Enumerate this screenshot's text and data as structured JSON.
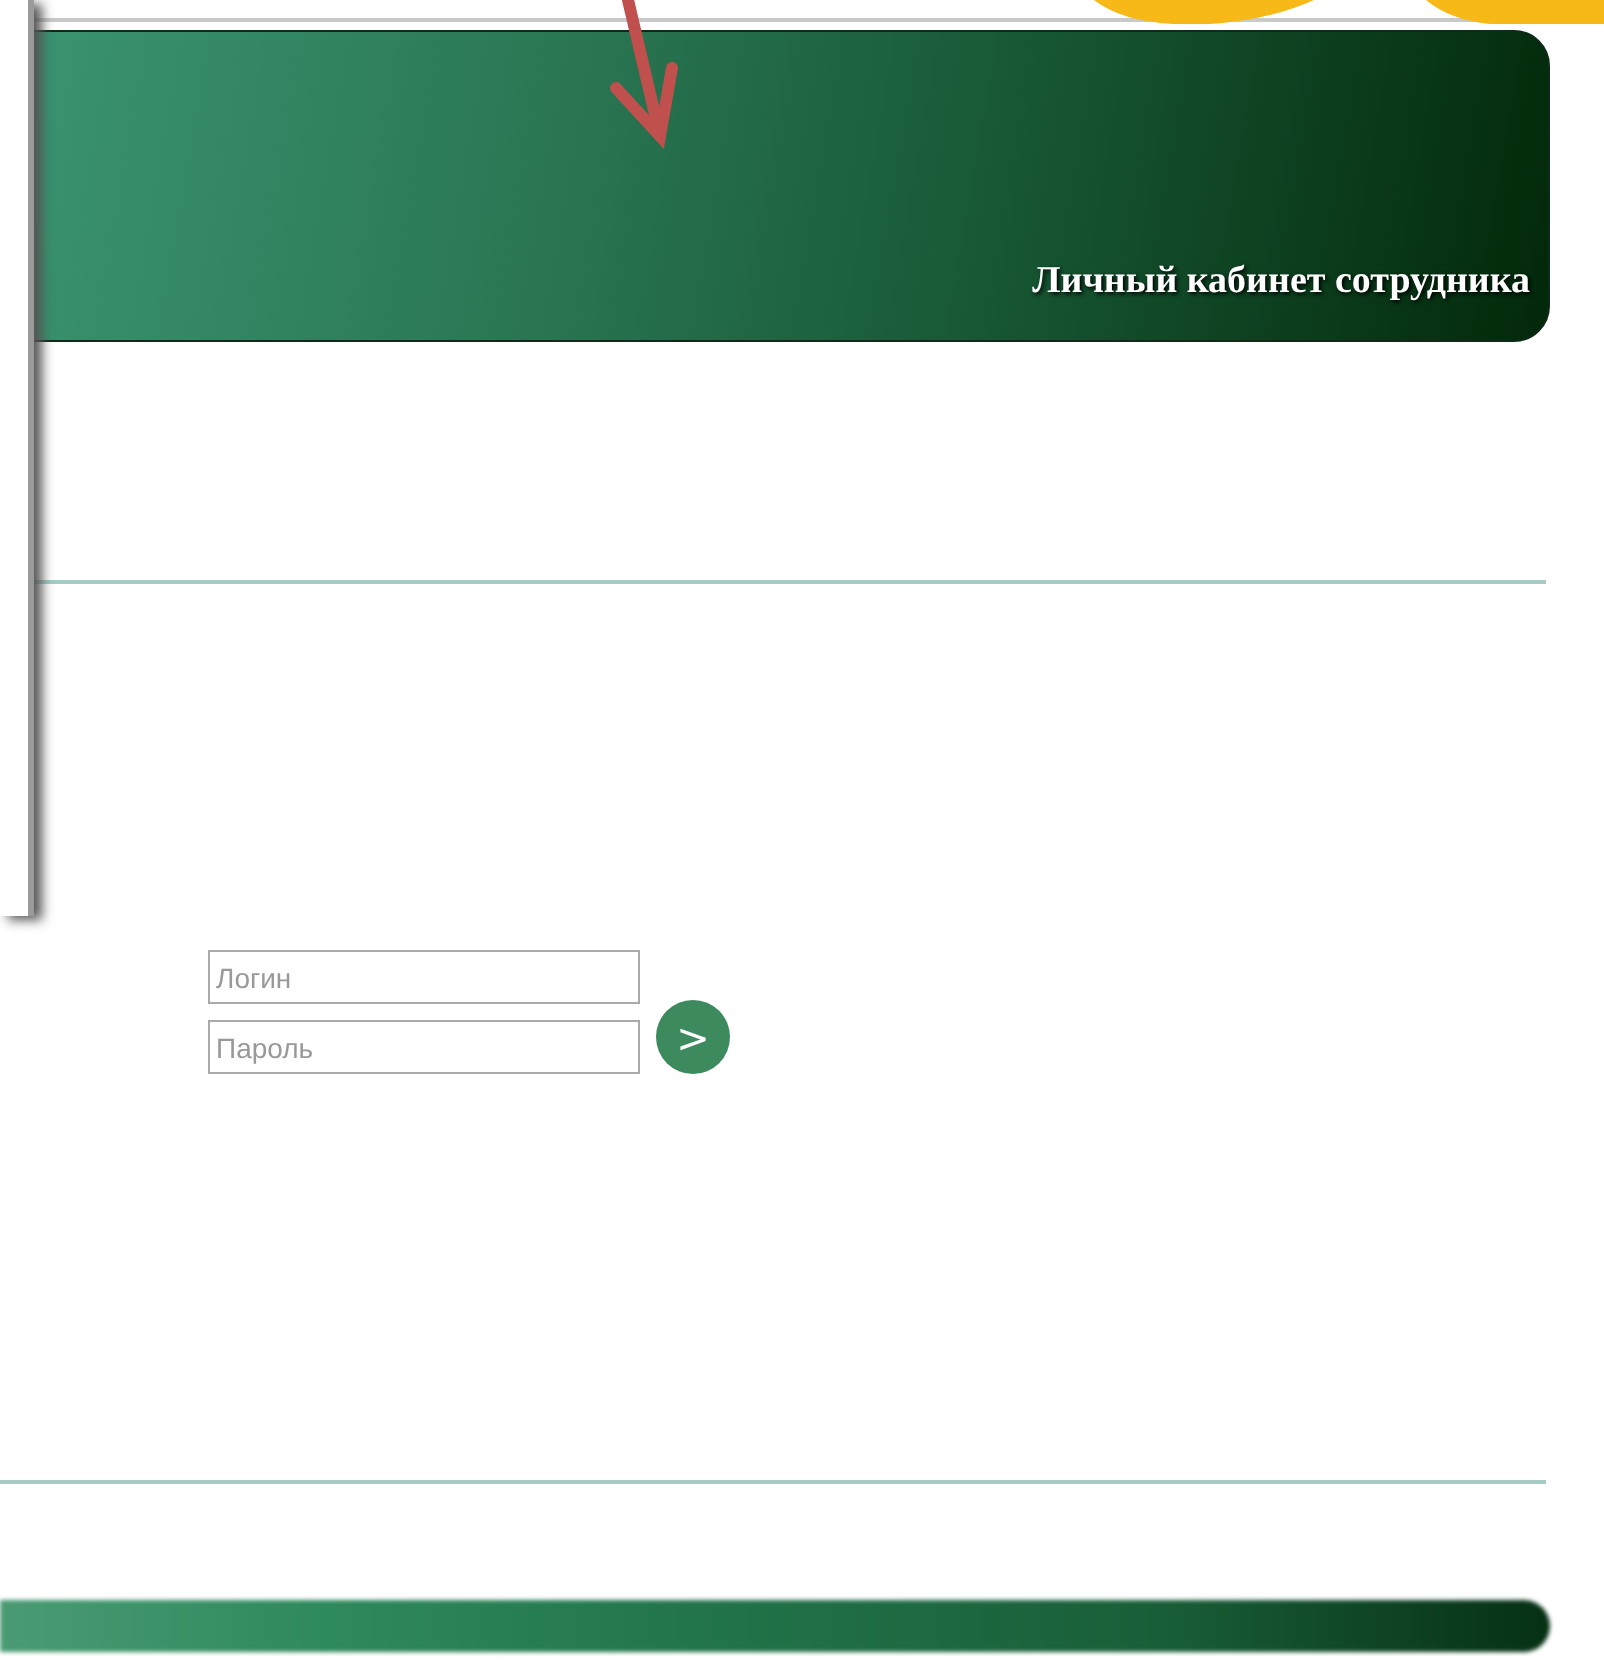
{
  "header": {
    "title": "Личный кабинет сотрудника"
  },
  "login_form": {
    "login": {
      "placeholder": "Логин"
    },
    "password": {
      "placeholder": "Пароль"
    },
    "submit": {
      "label": ">"
    }
  }
}
